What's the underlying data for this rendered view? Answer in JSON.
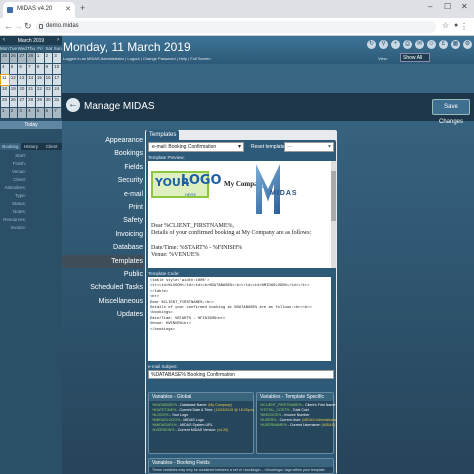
{
  "browser": {
    "tab_title": "MIDAS v4.20",
    "url": "demo.midas"
  },
  "calendar": {
    "month": "March 2019",
    "days": [
      "Mon",
      "Tue",
      "Wed",
      "Thu",
      "Fri",
      "Sat",
      "Sun"
    ],
    "cells": [
      "25",
      "26",
      "27",
      "28",
      "1",
      "2",
      "3",
      "4",
      "5",
      "6",
      "7",
      "8",
      "9",
      "10",
      "11",
      "12",
      "13",
      "14",
      "15",
      "16",
      "17",
      "18",
      "19",
      "20",
      "21",
      "22",
      "23",
      "24",
      "25",
      "26",
      "27",
      "28",
      "29",
      "30",
      "31",
      "1",
      "2",
      "3",
      "4",
      "5",
      "6",
      "7"
    ],
    "today_label": "Today"
  },
  "sidebar": {
    "tabs": [
      "Booking",
      "History",
      "Client"
    ],
    "fields": [
      "Start:",
      "Finish:",
      "Venue:",
      "Client:",
      "Attendees:",
      "Type:",
      "Status:",
      "Notes:",
      "Resources:",
      "Invoice:"
    ]
  },
  "header": {
    "date": "Monday, 11 March 2019",
    "links": "Logged in as MIDAS Administrator | Logout | Change Password | Help | Full Screen",
    "view_label": "View:",
    "view_value": "Show All"
  },
  "manage": {
    "title": "Manage MIDAS",
    "save_label": "Save Changes"
  },
  "categories": [
    "Appearance",
    "Bookings",
    "Fields",
    "Security",
    "e-mail",
    "Print",
    "Safety",
    "Invoicing",
    "Database",
    "Templates",
    "Public",
    "Scheduled Tasks",
    "Miscellaneous",
    "Updates"
  ],
  "templates": {
    "tab_label": "Templates",
    "email_template": "e-mail: Booking Confirmation",
    "reset_label": "Reset template to:",
    "reset_placeholder": "---",
    "preview_label": "Template Preview:",
    "logo_your": "YOUR",
    "logo_logo": "LOGO",
    "logo_here": "HERE",
    "company": "My Company",
    "midas_text": "MIDAS",
    "letter": [
      "Dear %CLIENT_FIRSTNAME%,",
      "Details of your confirmed booking at My Company are as follows:",
      "",
      "Date/Time: %START% - %FINISH%",
      "Venue: %VENUE%"
    ],
    "code_label": "Template Code:",
    "code": "<table style='width:100%'>\n<tr><td>%LOGO%</td><td><b>%DATABASE%</b></td><td>%MIDASLOGO%</td></tr>\n</table>\n<br>\nDear %CLIENT_FIRSTNAME%,<br>\nDetails of your confirmed booking at %DATABASE% are as follows:<br><br>\n<bookings>\nDate/Time: %START% - %FINISH%<br>\nVenue: %VENUE%<br>\n</bookings>",
    "subject_label": "e-mail Subject:",
    "subject": "%DATABASE% Booking Confirmation"
  },
  "variables": {
    "global_title": "Variables - Global",
    "global": [
      {
        "k": "%DATABASE%",
        "d": " - Database Name: ",
        "e": "(My Company)"
      },
      {
        "k": "%DATETIME%",
        "d": " - Current Date & Time: ",
        "e": "(11/03/2019 @ 18:25pm)"
      },
      {
        "k": "%LOGO%",
        "d": " - Your Logo",
        "e": ""
      },
      {
        "k": "%MIDASLOGO%",
        "d": " - MIDAS Logo",
        "e": ""
      },
      {
        "k": "%MIDASURL%",
        "d": " - MIDAS System URL",
        "e": ""
      },
      {
        "k": "%VERSION%",
        "d": " - Current MIDAS Version: ",
        "e": "(v4.20)"
      }
    ],
    "template_title": "Variables - Template Specific",
    "template": [
      {
        "k": "%CLIENT_FIRSTNAME%",
        "d": " - Client's First Name",
        "e": ""
      },
      {
        "k": "%TOTAL_COST%",
        "d": " - Total Cost",
        "e": ""
      },
      {
        "k": "%INVOICE%",
        "d": " - Invoice Number",
        "e": ""
      },
      {
        "k": "%USER%",
        "d": " - Current User: ",
        "e": "(MIDAS Administrator)"
      },
      {
        "k": "%USERNAME%",
        "d": " - Current Username: ",
        "e": "(MIDAS)"
      }
    ],
    "booking_title": "Variables - Booking Fields",
    "booking_note": "These variables may only be contained between a set of <bookings>...</bookings> tags within your template"
  }
}
